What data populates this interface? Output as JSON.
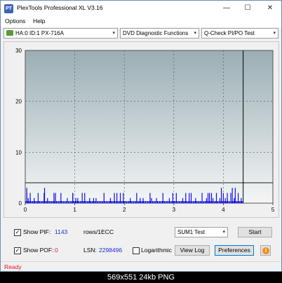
{
  "titlebar": {
    "app_icon_text": "PT",
    "title": "PlexTools Professional XL V3.16",
    "minimize": "—",
    "maximize": "☐",
    "close": "✕"
  },
  "menu": {
    "options": "Options",
    "help": "Help"
  },
  "toolbar": {
    "drive": "HA:0 ID:1  PX-716A",
    "function": "DVD Diagnostic Functions",
    "test": "Q-Check PI/PO Test",
    "arrow": "▾"
  },
  "chart_data": {
    "type": "bar",
    "x_ticks": [
      "0",
      "1",
      "2",
      "3",
      "4",
      "5"
    ],
    "y_ticks": [
      "0",
      "10",
      "20",
      "30"
    ],
    "xlim": [
      0,
      5
    ],
    "ylim": [
      0,
      30
    ],
    "threshold_line": 4,
    "test_end_x": 4.4,
    "grid": true,
    "colors": {
      "bars": "#1010e6",
      "sum_bars": "#1010e6",
      "gradient_top": "#9aaeb4",
      "gradient_bottom": "#f4f6f6"
    },
    "pi_bars": [
      {
        "x": 0.03,
        "y": 2
      },
      {
        "x": 0.06,
        "y": 1
      },
      {
        "x": 0.1,
        "y": 1
      },
      {
        "x": 0.18,
        "y": 1
      },
      {
        "x": 0.26,
        "y": 2
      },
      {
        "x": 0.39,
        "y": 3
      },
      {
        "x": 0.45,
        "y": 1
      },
      {
        "x": 0.58,
        "y": 2
      },
      {
        "x": 0.72,
        "y": 2
      },
      {
        "x": 0.85,
        "y": 1
      },
      {
        "x": 0.96,
        "y": 2
      },
      {
        "x": 1.02,
        "y": 1
      },
      {
        "x": 1.06,
        "y": 1
      },
      {
        "x": 1.2,
        "y": 2
      },
      {
        "x": 1.3,
        "y": 1
      },
      {
        "x": 1.43,
        "y": 1
      },
      {
        "x": 1.59,
        "y": 2
      },
      {
        "x": 1.72,
        "y": 1
      },
      {
        "x": 1.85,
        "y": 2
      },
      {
        "x": 1.98,
        "y": 2
      },
      {
        "x": 2.12,
        "y": 1
      },
      {
        "x": 2.25,
        "y": 2
      },
      {
        "x": 2.38,
        "y": 1
      },
      {
        "x": 2.52,
        "y": 2
      },
      {
        "x": 2.65,
        "y": 1
      },
      {
        "x": 2.78,
        "y": 2
      },
      {
        "x": 2.91,
        "y": 1
      },
      {
        "x": 3.05,
        "y": 2
      },
      {
        "x": 3.18,
        "y": 1
      },
      {
        "x": 3.31,
        "y": 2
      },
      {
        "x": 3.44,
        "y": 1
      },
      {
        "x": 3.57,
        "y": 2
      },
      {
        "x": 3.66,
        "y": 1
      },
      {
        "x": 3.72,
        "y": 2
      },
      {
        "x": 3.79,
        "y": 1
      },
      {
        "x": 3.86,
        "y": 2
      },
      {
        "x": 3.93,
        "y": 1
      },
      {
        "x": 4.0,
        "y": 2
      },
      {
        "x": 4.04,
        "y": 1
      },
      {
        "x": 4.08,
        "y": 1
      },
      {
        "x": 4.15,
        "y": 2
      },
      {
        "x": 4.22,
        "y": 1
      },
      {
        "x": 4.3,
        "y": 2
      },
      {
        "x": 4.36,
        "y": 1
      }
    ],
    "tall_bars": [
      {
        "x": 0.03,
        "y": 3
      },
      {
        "x": 0.1,
        "y": 2
      },
      {
        "x": 0.38,
        "y": 2
      },
      {
        "x": 0.61,
        "y": 2
      },
      {
        "x": 0.96,
        "y": 2
      },
      {
        "x": 1.15,
        "y": 2
      },
      {
        "x": 1.38,
        "y": 1
      },
      {
        "x": 1.8,
        "y": 2
      },
      {
        "x": 1.92,
        "y": 2
      },
      {
        "x": 2.32,
        "y": 1
      },
      {
        "x": 2.55,
        "y": 1
      },
      {
        "x": 2.98,
        "y": 2
      },
      {
        "x": 3.24,
        "y": 2
      },
      {
        "x": 3.35,
        "y": 2
      },
      {
        "x": 3.69,
        "y": 2
      },
      {
        "x": 3.76,
        "y": 2
      },
      {
        "x": 3.96,
        "y": 3
      },
      {
        "x": 4.08,
        "y": 2
      },
      {
        "x": 4.18,
        "y": 3
      },
      {
        "x": 4.24,
        "y": 3
      }
    ]
  },
  "controls": {
    "show_pif_check": "✓",
    "show_pif_label": "Show PIF:",
    "pif_value": "1143",
    "pif_unit": "rows/1ECC",
    "show_pof_check": "✓",
    "show_pof_label": "Show POF:",
    "pof_value": "0",
    "lsn_label": "LSN:",
    "lsn_value": "2298496",
    "log_check": "",
    "log_label": "Logarithmic",
    "sum_select": "SUM1 Test",
    "start_button": "Start",
    "view_log_button": "View Log",
    "preferences_button": "Preferences",
    "info_button": "i"
  },
  "status": {
    "text": "Ready"
  },
  "caption": {
    "text": "569x551  24kb  PNG"
  }
}
